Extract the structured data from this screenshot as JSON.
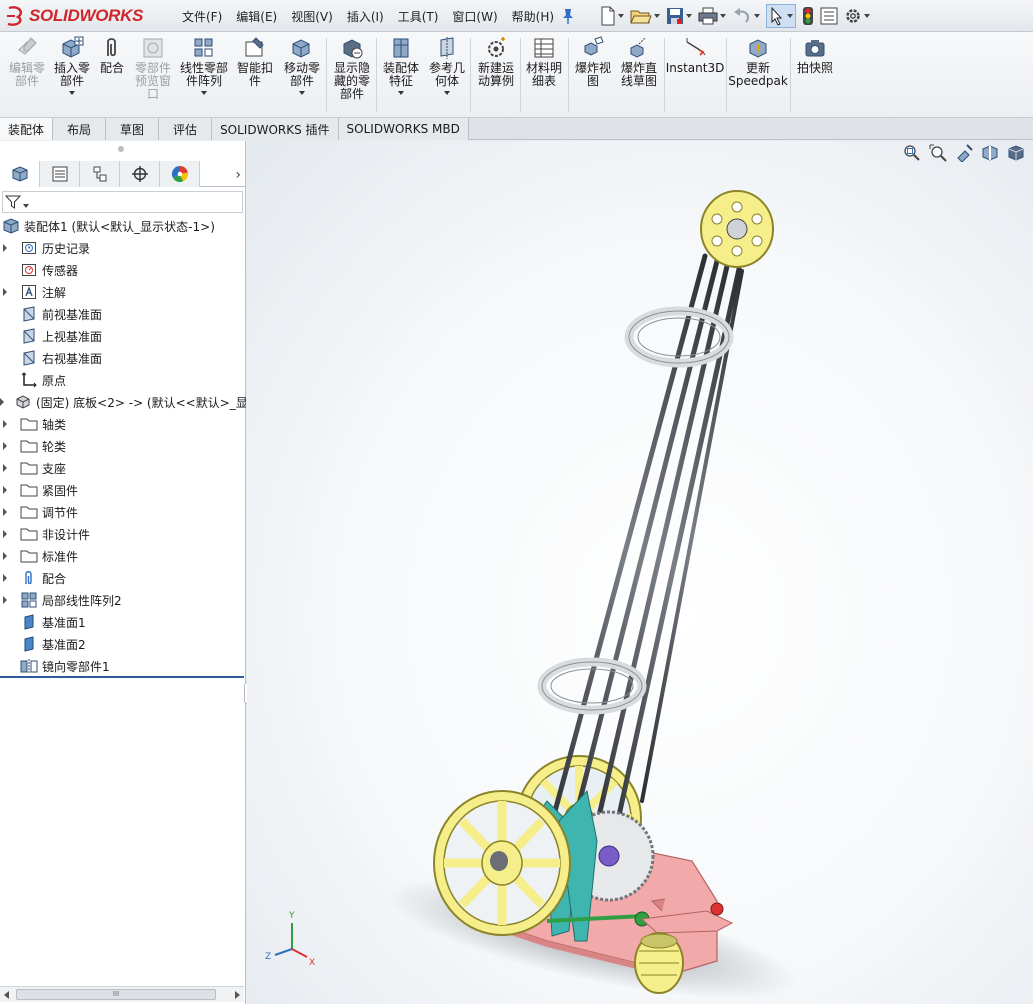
{
  "app": {
    "logo_prefix": "3S",
    "logo_name": "SOLIDWORKS"
  },
  "menu": [
    {
      "label": "文件(F)"
    },
    {
      "label": "编辑(E)"
    },
    {
      "label": "视图(V)"
    },
    {
      "label": "插入(I)"
    },
    {
      "label": "工具(T)"
    },
    {
      "label": "窗口(W)"
    },
    {
      "label": "帮助(H)"
    }
  ],
  "ribbon": {
    "buttons": [
      {
        "label": "编辑零\n部件",
        "icon": "edit-component-icon",
        "disabled": true
      },
      {
        "label": "插入零\n部件",
        "icon": "insert-component-icon",
        "disabled": false
      },
      {
        "label": "配合",
        "icon": "mate-icon",
        "disabled": false
      },
      {
        "label": "零部件\n预览窗\n口",
        "icon": "component-preview-icon",
        "disabled": true
      },
      {
        "label": "线性零部\n件阵列",
        "icon": "linear-pattern-icon",
        "disabled": false
      },
      {
        "label": "智能扣\n件",
        "icon": "smart-fastener-icon",
        "disabled": false
      },
      {
        "label": "移动零\n部件",
        "icon": "move-component-icon",
        "disabled": false
      },
      {
        "label": "显示隐\n藏的零\n部件",
        "icon": "show-hidden-icon",
        "disabled": false
      },
      {
        "label": "装配体\n特征",
        "icon": "assembly-feature-icon",
        "disabled": false
      },
      {
        "label": "参考几\n何体",
        "icon": "reference-geometry-icon",
        "disabled": false
      },
      {
        "label": "新建运\n动算例",
        "icon": "motion-study-icon",
        "disabled": false
      },
      {
        "label": "材料明\n细表",
        "icon": "bom-icon",
        "disabled": false
      },
      {
        "label": "爆炸视\n图",
        "icon": "exploded-view-icon",
        "disabled": false
      },
      {
        "label": "爆炸直\n线草图",
        "icon": "explode-line-icon",
        "disabled": false
      },
      {
        "label": "Instant3D",
        "icon": "instant3d-icon",
        "disabled": false
      },
      {
        "label": "更新\nSpeedpak",
        "icon": "speedpak-icon",
        "disabled": false
      },
      {
        "label": "拍快照",
        "icon": "snapshot-icon",
        "disabled": false
      }
    ]
  },
  "tabs": [
    {
      "label": "装配体"
    },
    {
      "label": "布局"
    },
    {
      "label": "草图"
    },
    {
      "label": "评估"
    },
    {
      "label": "SOLIDWORKS 插件"
    },
    {
      "label": "SOLIDWORKS MBD"
    }
  ],
  "tree": [
    {
      "label": "装配体1  (默认<默认_显示状态-1>)",
      "icon": "assembly-icon",
      "expander": false,
      "root": true
    },
    {
      "label": "历史记录",
      "icon": "history-icon",
      "expander": true
    },
    {
      "label": "传感器",
      "icon": "sensor-icon",
      "expander": false
    },
    {
      "label": "注解",
      "icon": "annotation-icon",
      "expander": true
    },
    {
      "label": "前视基准面",
      "icon": "plane-icon",
      "expander": false
    },
    {
      "label": "上视基准面",
      "icon": "plane-icon",
      "expander": false
    },
    {
      "label": "右视基准面",
      "icon": "plane-icon",
      "expander": false
    },
    {
      "label": "原点",
      "icon": "origin-icon",
      "expander": false
    },
    {
      "label": "(固定) 底板<2> -> (默认<<默认>_显",
      "icon": "part-icon",
      "expander": true
    },
    {
      "label": "轴类",
      "icon": "folder-icon",
      "expander": true
    },
    {
      "label": "轮类",
      "icon": "folder-icon",
      "expander": true
    },
    {
      "label": "支座",
      "icon": "folder-icon",
      "expander": true
    },
    {
      "label": "紧固件",
      "icon": "folder-icon",
      "expander": true
    },
    {
      "label": "调节件",
      "icon": "folder-icon",
      "expander": true
    },
    {
      "label": "非设计件",
      "icon": "folder-icon",
      "expander": true
    },
    {
      "label": "标准件",
      "icon": "folder-icon",
      "expander": true
    },
    {
      "label": "配合",
      "icon": "mates-icon",
      "expander": true
    },
    {
      "label": "局部线性阵列2",
      "icon": "pattern-icon",
      "expander": true
    },
    {
      "label": "基准面1",
      "icon": "datum-plane-icon",
      "expander": false
    },
    {
      "label": "基准面2",
      "icon": "datum-plane-icon",
      "expander": false
    },
    {
      "label": "镜向零部件1",
      "icon": "mirror-component-icon",
      "expander": false
    }
  ],
  "scrollbar": {
    "thumb_label": "III"
  },
  "triad": {
    "x": "X",
    "y": "Y",
    "z": "Z"
  },
  "colors": {
    "accent": "#2c5a9a",
    "logo_red": "#d0262b",
    "wheel_yellow": "#f5ee8a",
    "base_pink": "#f2a9a9",
    "bracket_teal": "#3fb5b0"
  }
}
